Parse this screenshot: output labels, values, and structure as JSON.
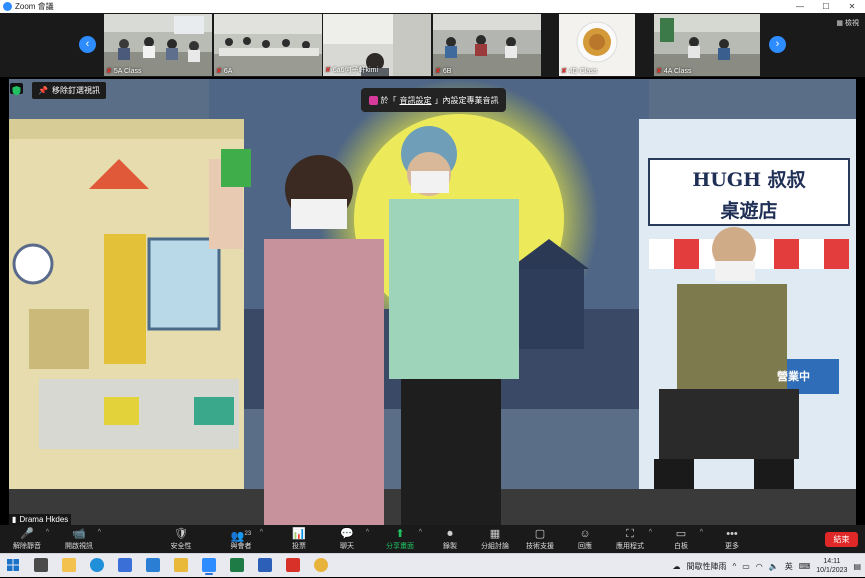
{
  "window": {
    "title": "Zoom 會議",
    "controls": [
      "—",
      "☐",
      "✕"
    ]
  },
  "thumbnail_strip": {
    "prev_arrow": "‹",
    "next_arrow": "›",
    "gallery_label": "檢視",
    "thumbs": [
      {
        "label": "5A Class"
      },
      {
        "label": "6A"
      },
      {
        "label": "6a6何子軒kimi"
      },
      {
        "label": "6B"
      },
      {
        "label": "4D Class"
      },
      {
        "label": "4A Class"
      }
    ]
  },
  "stage": {
    "pin_label": "移除釘選視訊",
    "toast": {
      "pre": "於「",
      "link": "音訊設定",
      "post": "」內設定專業音訊"
    },
    "speaker_name": "Drama Hkdes",
    "sign_line1": "HUGH 叔叔",
    "sign_line2": "桌遊店",
    "sign_small": "營業中"
  },
  "toolbar": {
    "items": [
      {
        "icon": "🎤",
        "label": "解除靜音",
        "caret": true
      },
      {
        "icon": "📹",
        "label": "開啟視訊",
        "caret": true
      },
      {
        "icon": "🛡",
        "label": "安全性",
        "caret": false
      },
      {
        "icon": "👥",
        "label": "與會者",
        "caret": true,
        "count": "23"
      },
      {
        "icon": "📊",
        "label": "投票",
        "caret": false
      },
      {
        "icon": "💬",
        "label": "聊天",
        "caret": true
      },
      {
        "icon": "⬆",
        "label": "分享畫面",
        "caret": true
      },
      {
        "icon": "⏺",
        "label": "錄製",
        "caret": false
      },
      {
        "icon": "▦",
        "label": "分組討論",
        "caret": false
      },
      {
        "icon": "▢",
        "label": "技術支援",
        "caret": false
      },
      {
        "icon": "☺",
        "label": "回應",
        "caret": false
      },
      {
        "icon": "⛶",
        "label": "應用程式",
        "caret": true
      },
      {
        "icon": "▭",
        "label": "白板",
        "caret": true
      },
      {
        "icon": "•••",
        "label": "更多",
        "caret": false
      }
    ],
    "end_label": "結束"
  },
  "taskbar": {
    "weather_label": "間歇性陣雨",
    "ime": "英",
    "time": "14:11",
    "date": "10/1/2023"
  },
  "colors": {
    "zoom_blue": "#2d8cff",
    "end_red": "#e02828",
    "share_green": "#21c063"
  }
}
